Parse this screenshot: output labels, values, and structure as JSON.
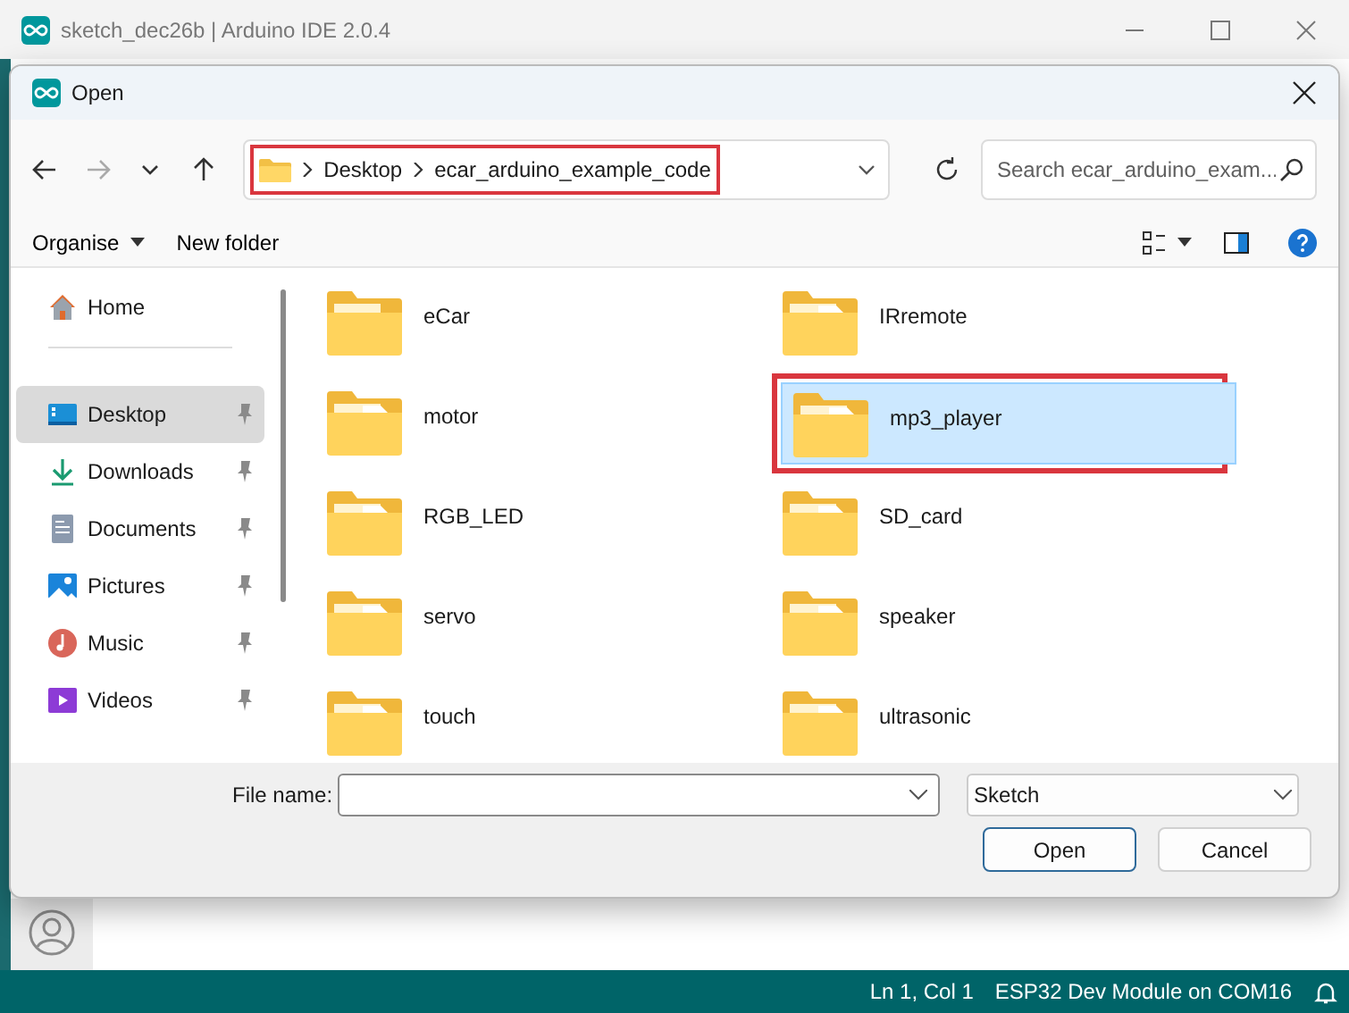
{
  "ide": {
    "title": "sketch_dec26b | Arduino IDE 2.0.4",
    "status": [
      "Ln 1, Col 1",
      "ESP32 Dev Module on COM16"
    ]
  },
  "dialog": {
    "title": "Open",
    "nav": {
      "back_enabled": true,
      "forward_enabled": false
    },
    "path": {
      "crumbs": [
        "Desktop",
        "ecar_arduino_example_code"
      ],
      "highlighted": true
    },
    "search": {
      "placeholder": "Search ecar_arduino_exam..."
    },
    "toolbar": {
      "organise": "Organise",
      "new_folder": "New folder"
    },
    "sidebar": [
      {
        "label": "Home",
        "kind": "home",
        "selected": false,
        "pinned": false
      },
      {
        "label": "Desktop",
        "kind": "desktop",
        "selected": true,
        "pinned": true
      },
      {
        "label": "Downloads",
        "kind": "downloads",
        "selected": false,
        "pinned": true
      },
      {
        "label": "Documents",
        "kind": "documents",
        "selected": false,
        "pinned": true
      },
      {
        "label": "Pictures",
        "kind": "pictures",
        "selected": false,
        "pinned": true
      },
      {
        "label": "Music",
        "kind": "music",
        "selected": false,
        "pinned": true
      },
      {
        "label": "Videos",
        "kind": "videos",
        "selected": false,
        "pinned": true
      }
    ],
    "files": [
      {
        "name": "eCar",
        "kind": "marked",
        "selected": false,
        "highlighted": false
      },
      {
        "name": "IRremote",
        "kind": "plain",
        "selected": false,
        "highlighted": false
      },
      {
        "name": "motor",
        "kind": "plain",
        "selected": false,
        "highlighted": false
      },
      {
        "name": "mp3_player",
        "kind": "plain",
        "selected": true,
        "highlighted": true
      },
      {
        "name": "RGB_LED",
        "kind": "plain",
        "selected": false,
        "highlighted": false
      },
      {
        "name": "SD_card",
        "kind": "plain",
        "selected": false,
        "highlighted": false
      },
      {
        "name": "servo",
        "kind": "plain",
        "selected": false,
        "highlighted": false
      },
      {
        "name": "speaker",
        "kind": "plain",
        "selected": false,
        "highlighted": false
      },
      {
        "name": "touch",
        "kind": "plain",
        "selected": false,
        "highlighted": false
      },
      {
        "name": "ultrasonic",
        "kind": "plain",
        "selected": false,
        "highlighted": false
      }
    ],
    "file_name_label": "File name:",
    "file_type": "Sketch",
    "buttons": [
      {
        "label": "Open",
        "default": true
      },
      {
        "label": "Cancel",
        "default": false
      }
    ]
  }
}
